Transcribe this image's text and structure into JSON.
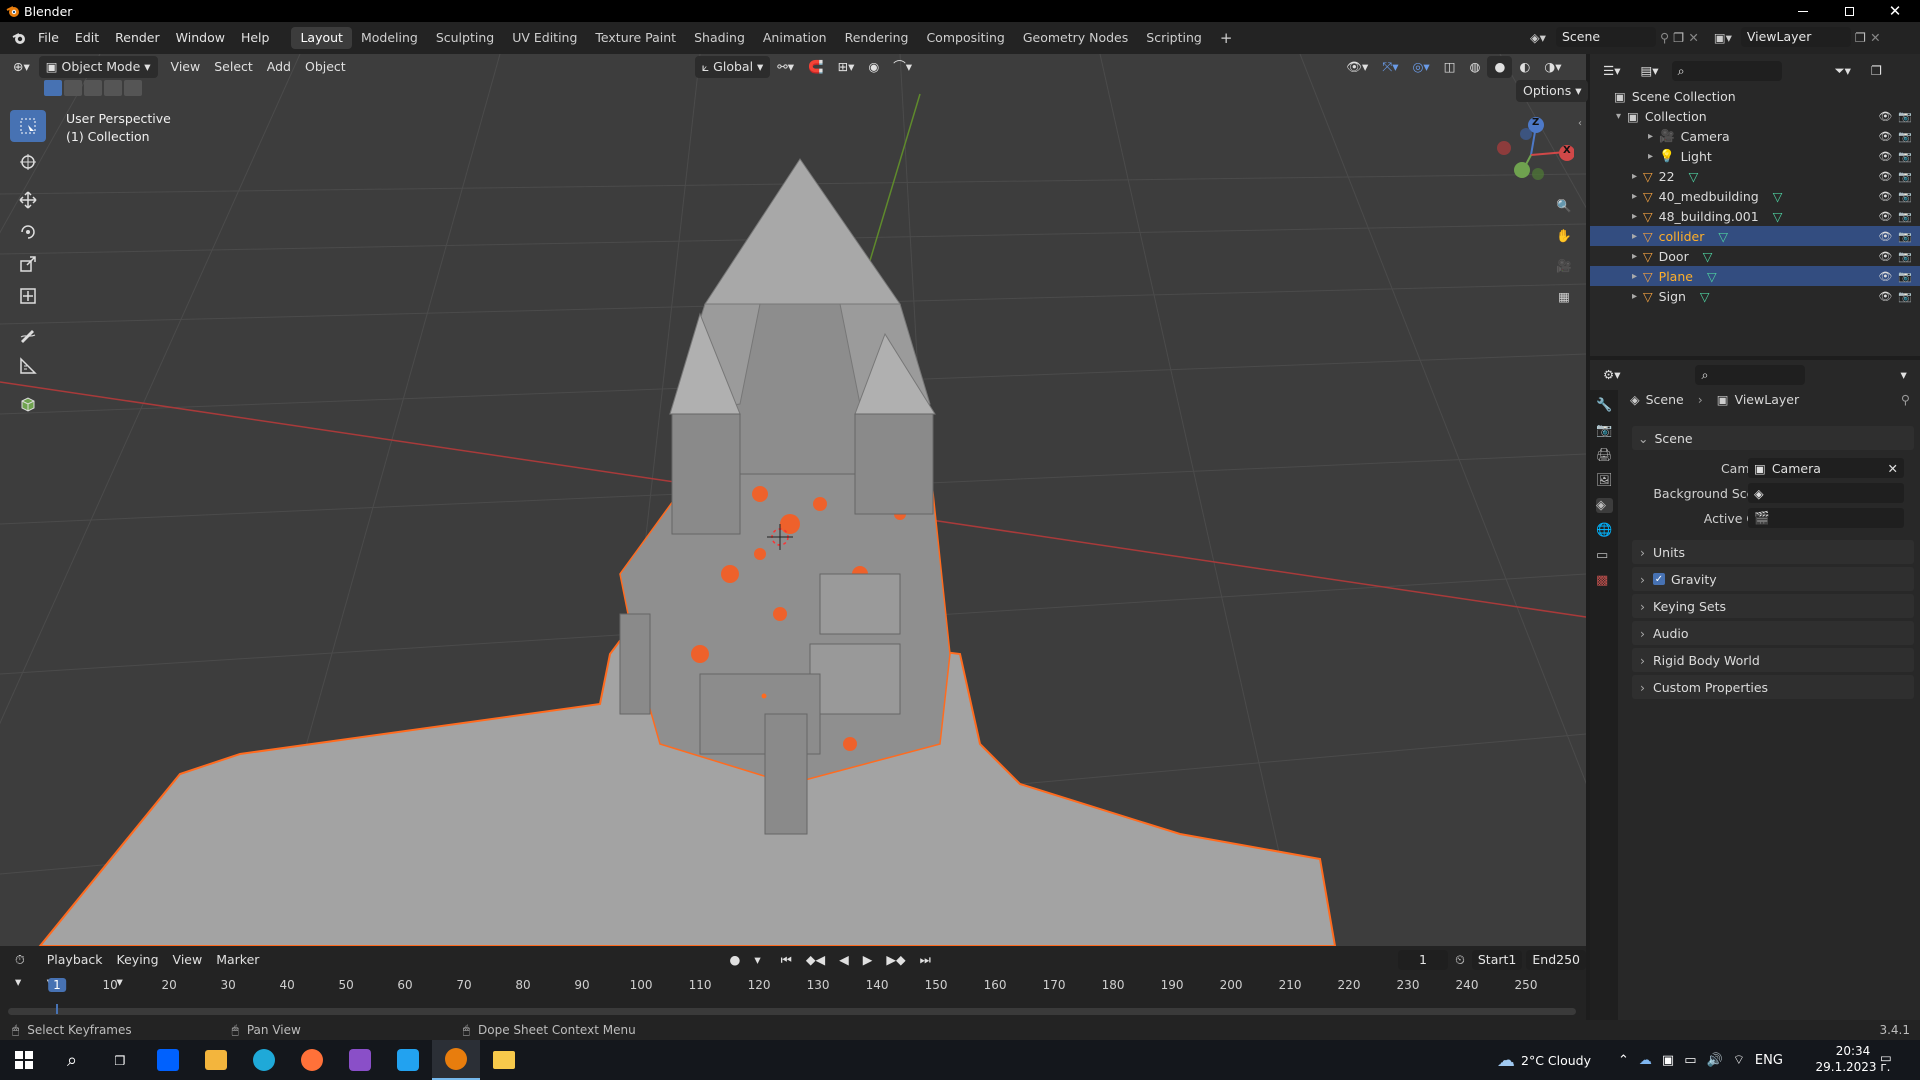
{
  "app": {
    "title": "Blender",
    "version": "3.4.1"
  },
  "menus": [
    "File",
    "Edit",
    "Render",
    "Window",
    "Help"
  ],
  "workspaces": [
    "Layout",
    "Modeling",
    "Sculpting",
    "UV Editing",
    "Texture Paint",
    "Shading",
    "Animation",
    "Rendering",
    "Compositing",
    "Geometry Nodes",
    "Scripting"
  ],
  "active_workspace": "Layout",
  "scene_field": "Scene",
  "viewlayer_field": "ViewLayer",
  "viewport": {
    "mode": "Object Mode",
    "menus": [
      "View",
      "Select",
      "Add",
      "Object"
    ],
    "transform_orientation": "Global",
    "options_label": "Options",
    "overlay_line1": "User Perspective",
    "overlay_line2": "(1) Collection",
    "gizmo_axes": {
      "z": "Z",
      "x": "X"
    }
  },
  "outliner": {
    "root": "Scene Collection",
    "items": [
      {
        "name": "Collection",
        "type": "collection",
        "expanded": true
      },
      {
        "name": "Camera",
        "type": "camera",
        "indent": 2
      },
      {
        "name": "Light",
        "type": "light",
        "indent": 2
      },
      {
        "name": "22",
        "type": "mesh",
        "indent": 1
      },
      {
        "name": "40_medbuilding",
        "type": "mesh",
        "indent": 1
      },
      {
        "name": "48_building.001",
        "type": "mesh",
        "indent": 1
      },
      {
        "name": "collider",
        "type": "mesh",
        "indent": 1,
        "selected": true
      },
      {
        "name": "Door",
        "type": "mesh",
        "indent": 1
      },
      {
        "name": "Plane",
        "type": "mesh",
        "indent": 1,
        "selected": true
      },
      {
        "name": "Sign",
        "type": "mesh",
        "indent": 1
      }
    ]
  },
  "properties": {
    "breadcrumb": [
      "Scene",
      "ViewLayer"
    ],
    "section_scene": "Scene",
    "camera_label": "Camera",
    "camera_value": "Camera",
    "background_scene_label": "Background Scene",
    "active_clip_label": "Active Clip",
    "sections": [
      "Units",
      "Gravity",
      "Keying Sets",
      "Audio",
      "Rigid Body World",
      "Custom Properties"
    ]
  },
  "timeline": {
    "menus": [
      "Playback",
      "Keying",
      "View",
      "Marker"
    ],
    "current_frame": "1",
    "start_label": "Start",
    "start": "1",
    "end_label": "End",
    "end": "250",
    "ticks": [
      "1",
      "10",
      "20",
      "30",
      "40",
      "50",
      "60",
      "70",
      "80",
      "90",
      "100",
      "110",
      "120",
      "130",
      "140",
      "150",
      "160",
      "170",
      "180",
      "190",
      "200",
      "210",
      "220",
      "230",
      "240",
      "250"
    ]
  },
  "statusbar": {
    "left": "Select Keyframes",
    "middle": "Pan View",
    "right": "Dope Sheet Context Menu"
  },
  "taskbar": {
    "weather": "2°C Cloudy",
    "language": "ENG",
    "time": "20:34",
    "date": "29.1.2023 г."
  },
  "colors": {
    "accent": "#4772b3",
    "selection_orange": "#ff6b1f",
    "selected_row": "#334d80"
  }
}
